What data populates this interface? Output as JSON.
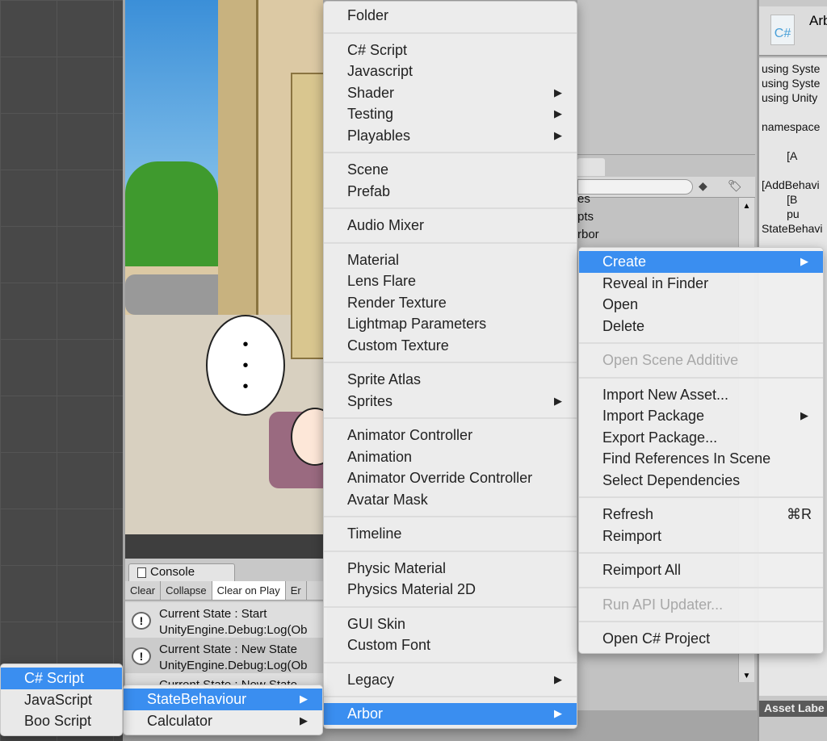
{
  "console": {
    "tab": "Console",
    "toolbar": [
      "Clear",
      "Collapse",
      "Clear on Play",
      "Er"
    ],
    "rows": [
      {
        "l1": "Current State : Start",
        "l2": "UnityEngine.Debug:Log(Ob"
      },
      {
        "l1": "Current State : New State",
        "l2": "UnityEngine.Debug:Log(Ob"
      },
      {
        "l1": "Current State : New State",
        "l2": ""
      }
    ]
  },
  "project": {
    "items": [
      "es",
      "pts",
      "rbor"
    ]
  },
  "inspector": {
    "title": "Arb",
    "icon_label": "C#",
    "code": [
      "using Syste",
      "using Syste",
      "using Unity",
      "",
      "namespace",
      "",
      "        [A",
      "",
      "[AddBehavi",
      "        [B",
      "        pu",
      "StateBehavi"
    ],
    "asset_labels": "Asset Labe"
  },
  "game": {
    "bubble_dots": "•\n•\n•"
  },
  "menus": {
    "main": [
      [
        {
          "label": "Folder"
        }
      ],
      [
        {
          "label": "C# Script"
        },
        {
          "label": "Javascript"
        },
        {
          "label": "Shader",
          "sub": true
        },
        {
          "label": "Testing",
          "sub": true
        },
        {
          "label": "Playables",
          "sub": true
        }
      ],
      [
        {
          "label": "Scene"
        },
        {
          "label": "Prefab"
        }
      ],
      [
        {
          "label": "Audio Mixer"
        }
      ],
      [
        {
          "label": "Material"
        },
        {
          "label": "Lens Flare"
        },
        {
          "label": "Render Texture"
        },
        {
          "label": "Lightmap Parameters"
        },
        {
          "label": "Custom Texture"
        }
      ],
      [
        {
          "label": "Sprite Atlas"
        },
        {
          "label": "Sprites",
          "sub": true
        }
      ],
      [
        {
          "label": "Animator Controller"
        },
        {
          "label": "Animation"
        },
        {
          "label": "Animator Override Controller"
        },
        {
          "label": "Avatar Mask"
        }
      ],
      [
        {
          "label": "Timeline"
        }
      ],
      [
        {
          "label": "Physic Material"
        },
        {
          "label": "Physics Material 2D"
        }
      ],
      [
        {
          "label": "GUI Skin"
        },
        {
          "label": "Custom Font"
        }
      ],
      [
        {
          "label": "Legacy",
          "sub": true
        }
      ],
      [
        {
          "label": "Arbor",
          "sub": true,
          "highlighted": true
        }
      ]
    ],
    "context": [
      [
        {
          "label": "Create",
          "sub": true,
          "highlighted": true
        },
        {
          "label": "Reveal in Finder"
        },
        {
          "label": "Open"
        },
        {
          "label": "Delete"
        }
      ],
      [
        {
          "label": "Open Scene Additive",
          "disabled": true
        }
      ],
      [
        {
          "label": "Import New Asset..."
        },
        {
          "label": "Import Package",
          "sub": true
        },
        {
          "label": "Export Package..."
        },
        {
          "label": "Find References In Scene"
        },
        {
          "label": "Select Dependencies"
        }
      ],
      [
        {
          "label": "Refresh",
          "shortcut": "⌘R"
        },
        {
          "label": "Reimport"
        }
      ],
      [
        {
          "label": "Reimport All"
        }
      ],
      [
        {
          "label": "Run API Updater...",
          "disabled": true
        }
      ],
      [
        {
          "label": "Open C# Project"
        }
      ]
    ],
    "arbor": [
      [
        {
          "label": "StateBehaviour",
          "sub": true,
          "highlighted": true
        },
        {
          "label": "Calculator",
          "sub": true
        }
      ]
    ],
    "statebehaviour": [
      [
        {
          "label": "C# Script",
          "highlighted": true
        },
        {
          "label": "JavaScript"
        },
        {
          "label": "Boo Script"
        }
      ]
    ]
  },
  "colors": {
    "highlight": "#3a8ef0"
  }
}
